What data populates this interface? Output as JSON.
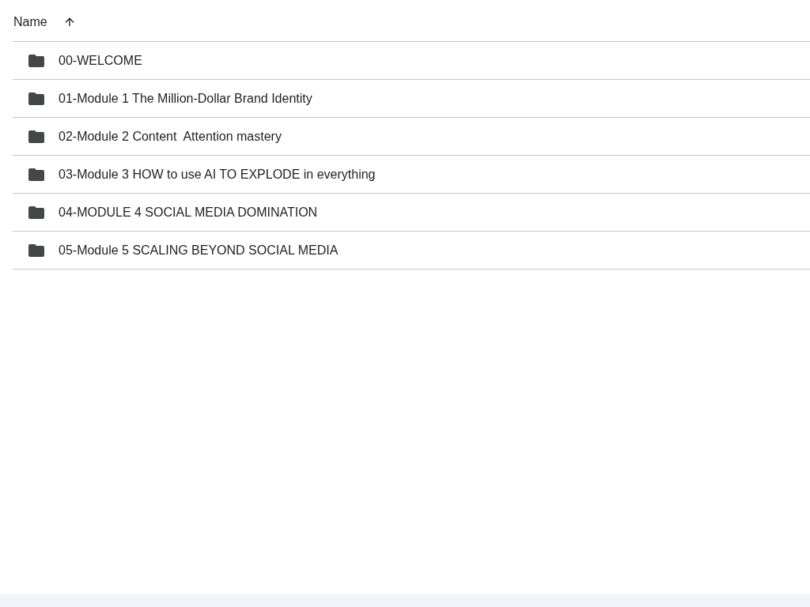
{
  "table": {
    "columns": [
      {
        "label": "Name",
        "sorted_ascending": true
      }
    ],
    "rows": [
      {
        "kind": "folder",
        "name": "00-WELCOME"
      },
      {
        "kind": "folder",
        "name": "01-Module 1 The Million-Dollar Brand Identity"
      },
      {
        "kind": "folder",
        "name": "02-Module 2 Content  Attention mastery"
      },
      {
        "kind": "folder",
        "name": "03-Module 3 HOW to use AI TO EXPLODE in everything"
      },
      {
        "kind": "folder",
        "name": "04-MODULE 4 SOCIAL MEDIA DOMINATION"
      },
      {
        "kind": "folder",
        "name": "05-Module 5 SCALING BEYOND SOCIAL MEDIA"
      }
    ]
  }
}
